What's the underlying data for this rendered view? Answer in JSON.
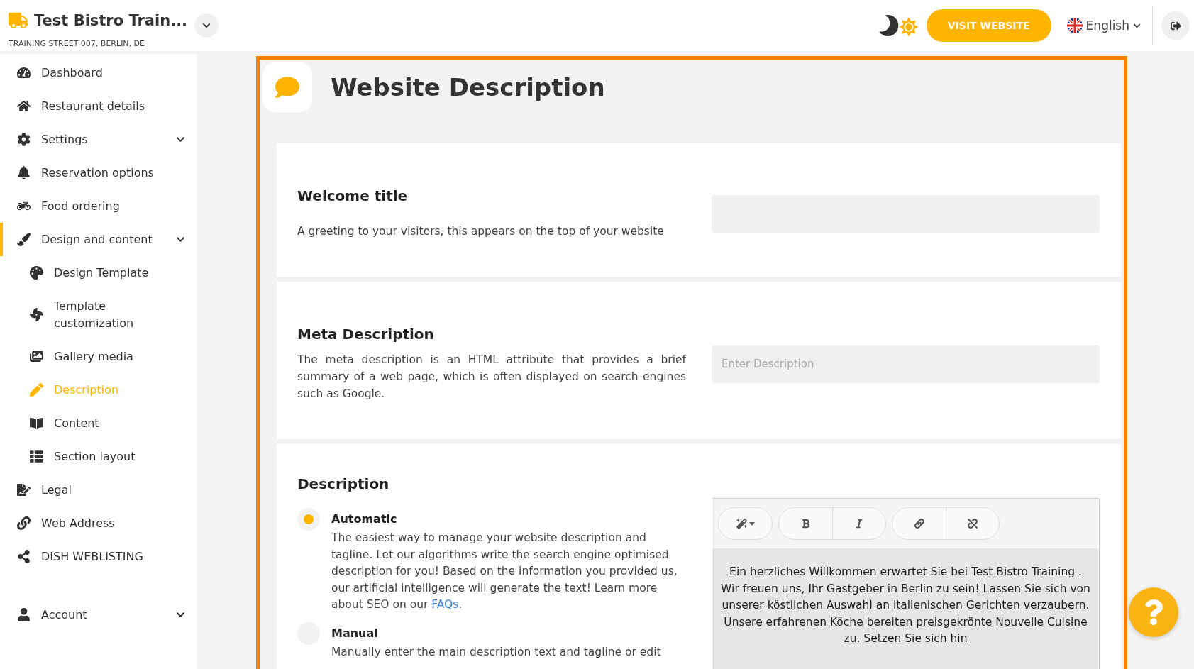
{
  "header": {
    "restaurant_name": "Test Bistro Train...",
    "address": "TRAINING STREET 007, BERLIN, DE",
    "visit_button": "VISIT WEBSITE",
    "language": "English"
  },
  "sidebar": {
    "items": [
      {
        "label": "Dashboard",
        "selected": false
      },
      {
        "label": "Restaurant details",
        "selected": false
      },
      {
        "label": "Settings",
        "selected": false,
        "expandable": true
      },
      {
        "label": "Reservation options",
        "selected": false
      },
      {
        "label": "Food ordering",
        "selected": false
      },
      {
        "label": "Design and content",
        "selected": true,
        "expandable": true,
        "children": [
          {
            "label": "Design Template",
            "selected": false
          },
          {
            "label": "Template customization",
            "selected": false
          },
          {
            "label": "Gallery media",
            "selected": false
          },
          {
            "label": "Description",
            "selected": true
          },
          {
            "label": "Content",
            "selected": false
          },
          {
            "label": "Section layout",
            "selected": false
          }
        ]
      },
      {
        "label": "Legal",
        "selected": false
      },
      {
        "label": "Web Address",
        "selected": false
      },
      {
        "label": "DISH WEBLISTING",
        "selected": false
      },
      {
        "label": "Account",
        "selected": false,
        "expandable": true
      }
    ]
  },
  "page": {
    "title": "Website Description",
    "sections": [
      {
        "kind": "input",
        "title": "Welcome title",
        "text": "A greeting to your visitors, this appears on the top of your website"
      },
      {
        "kind": "input",
        "title": "Meta Description",
        "text": "The meta description is an HTML attribute that provides a brief summary of a web page, which is often displayed on search engines such as Google.",
        "placeholder": "Enter Description"
      },
      {
        "kind": "choice",
        "title": "Description",
        "options": [
          {
            "label": "Automatic",
            "selected": true,
            "text": "The easiest way to manage your website description and tagline. Let our algorithms write the search engine optimised description for you! Based on the information you provided us, our artificial intelligence will generate the text! Learn more about SEO on our ",
            "link": "FAQs",
            "after": "."
          },
          {
            "label": "Manual",
            "selected": false,
            "text": "Manually enter the main description text and tagline or edit"
          }
        ],
        "editor": {
          "text": "Ein herzliches Willkommen erwartet Sie bei Test Bistro Training . Wir freuen uns, Ihr Gastgeber in Berlin zu sein! Lassen Sie sich von unserer köstlichen Auswahl an italienischen Gerichten verzaubern. Unsere erfahrenen Köche bereiten preisgekrönte Nouvelle Cuisine zu. Setzen Sie sich hin"
        }
      }
    ]
  }
}
